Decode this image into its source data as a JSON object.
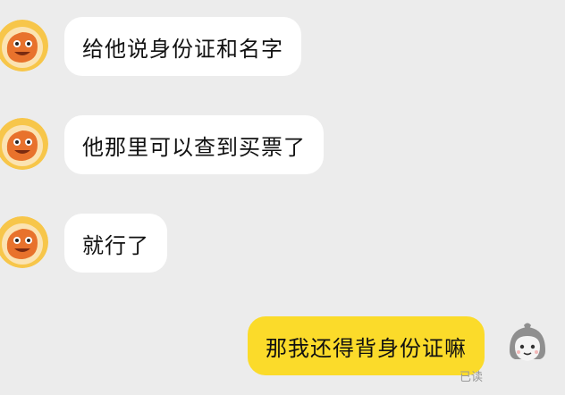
{
  "messages": [
    {
      "direction": "incoming",
      "text": "给他说身份证和名字"
    },
    {
      "direction": "incoming",
      "text": "他那里可以查到买票了"
    },
    {
      "direction": "incoming",
      "text": "就行了"
    },
    {
      "direction": "outgoing",
      "text": "那我还得背身份证嘛"
    }
  ],
  "read_status": "已读",
  "colors": {
    "background": "#ececec",
    "incoming_bubble": "#ffffff",
    "outgoing_bubble": "#fbdb2a",
    "contact_avatar_ring": "#f7c64a",
    "contact_avatar_character": "#e8722c"
  },
  "icons": {
    "contact_avatar": "orange-mascot-avatar-icon",
    "own_avatar": "gray-hooded-character-avatar-icon"
  }
}
